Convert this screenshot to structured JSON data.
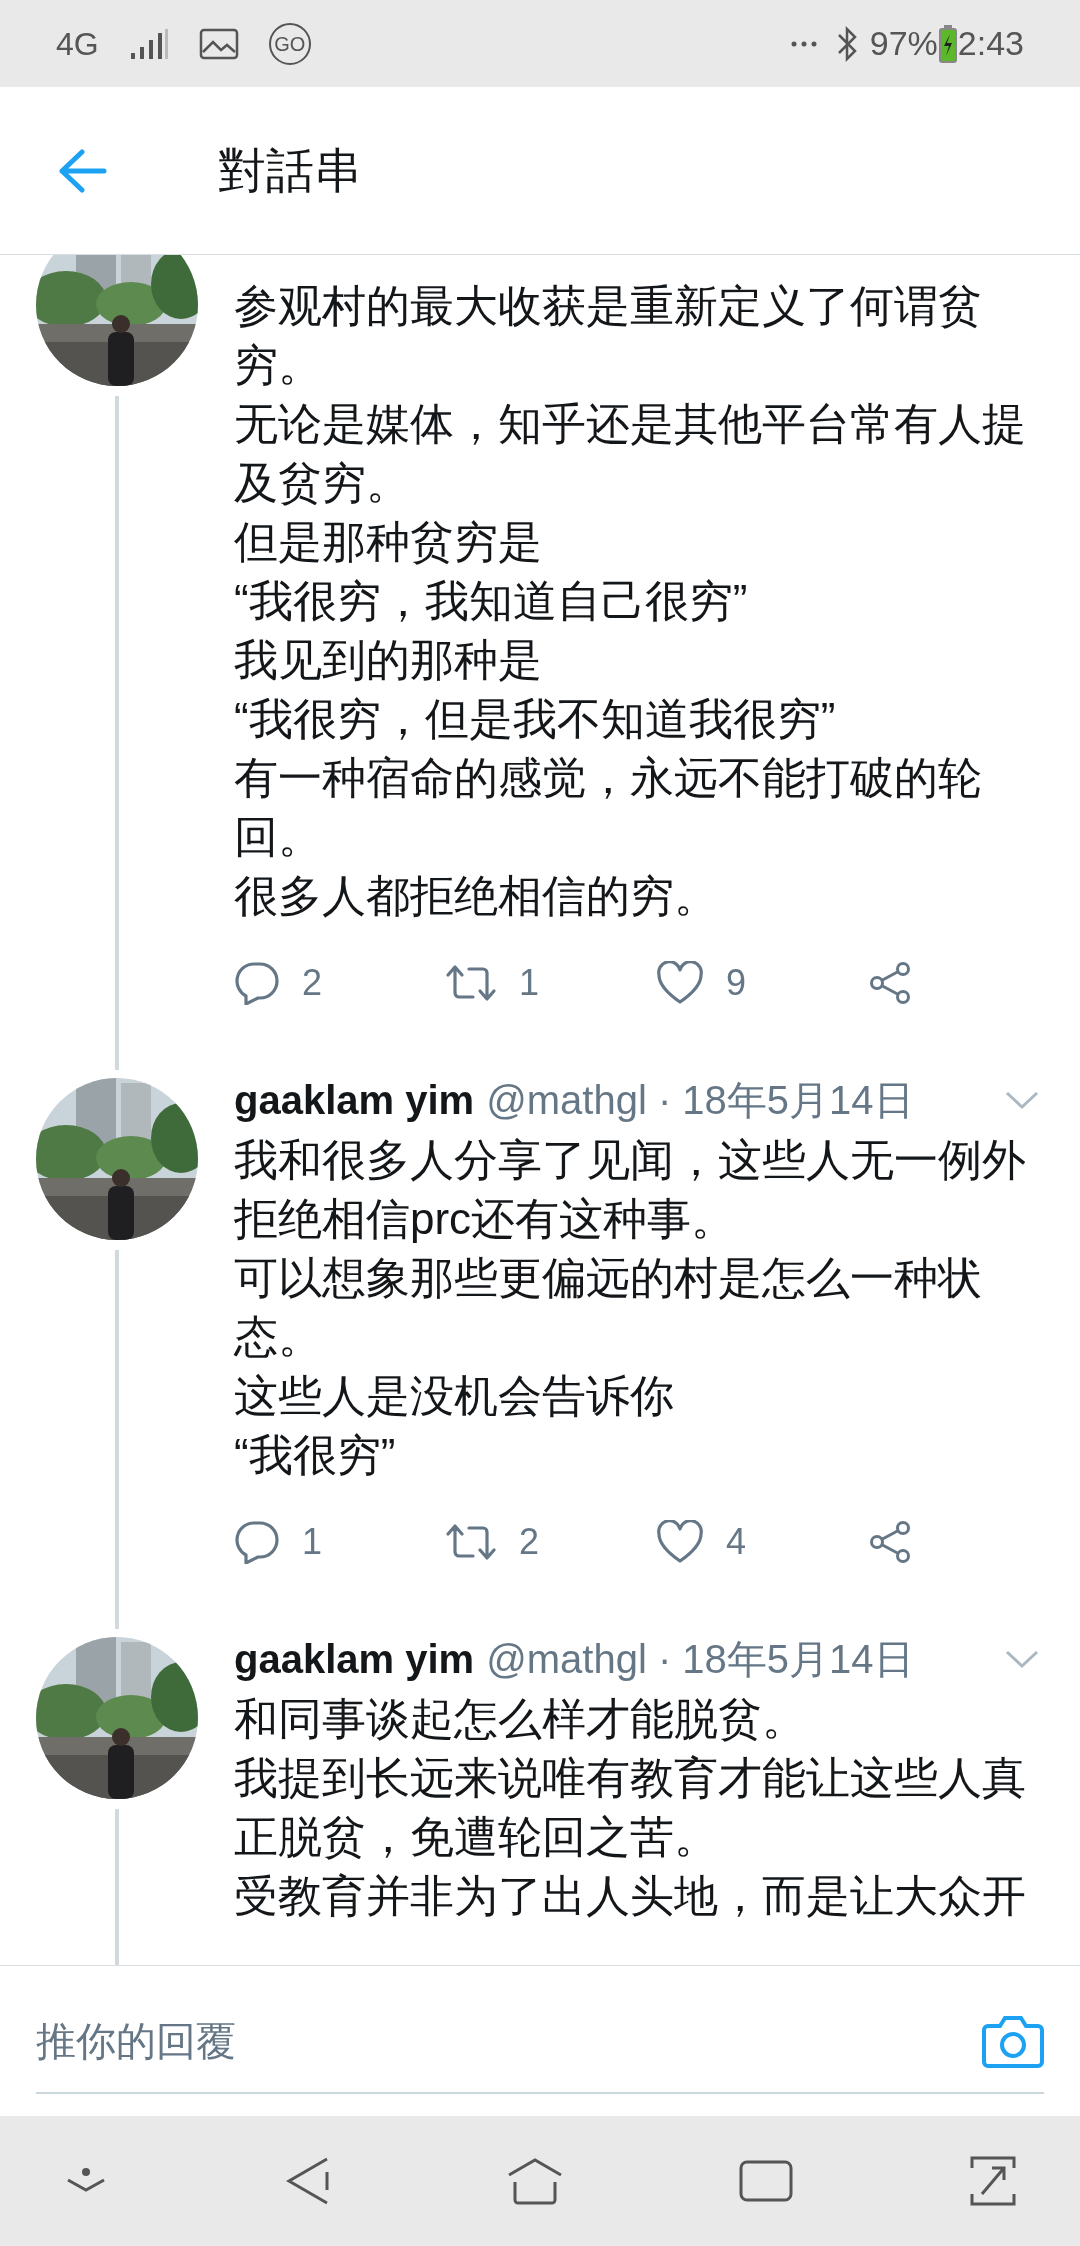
{
  "status_bar": {
    "network": "4G",
    "app_badge": "GO",
    "battery": "97%",
    "time": "2:43"
  },
  "header": {
    "title": "對話串"
  },
  "tweets": [
    {
      "paragraphs": [
        "参观村的最大收获是重新定义了何谓贫穷。",
        "无论是媒体，知乎还是其他平台常有人提及贫穷。",
        "但是那种贫穷是",
        "“我很穷，我知道自己很穷”",
        "我见到的那种是",
        "“我很穷，但是我不知道我很穷”",
        "有一种宿命的感觉，永远不能打破的轮回。",
        "很多人都拒绝相信的穷。"
      ],
      "replies": "2",
      "retweets": "1",
      "likes": "9"
    },
    {
      "name": "gaaklam yim",
      "handle": "@mathgl · 18年5月14日",
      "paragraphs": [
        "我和很多人分享了见闻，这些人无一例外拒绝相信prc还有这种事。",
        "可以想象那些更偏远的村是怎么一种状态。",
        "这些人是没机会告诉你",
        "“我很穷”"
      ],
      "replies": "1",
      "retweets": "2",
      "likes": "4"
    },
    {
      "name": "gaaklam yim",
      "handle": "@mathgl · 18年5月14日",
      "paragraphs": [
        "和同事谈起怎么样才能脱贫。",
        "我提到长远来说唯有教育才能让这些人真正脱贫，免遭轮回之苦。",
        "受教育并非为了出人头地，而是让大众开"
      ]
    }
  ],
  "reply_bar": {
    "placeholder": "推你的回覆"
  }
}
